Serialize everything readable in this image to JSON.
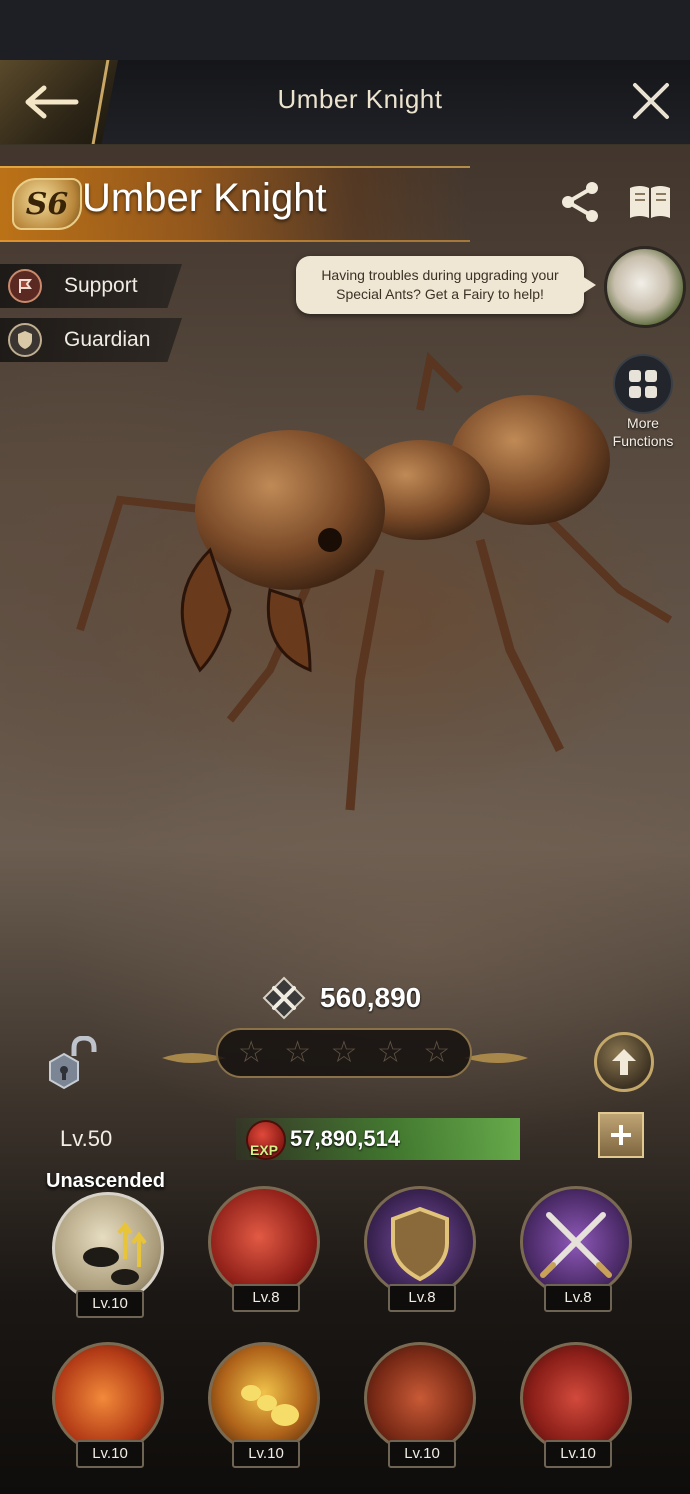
{
  "header": {
    "title": "Umber Knight"
  },
  "hero": {
    "grade": "S6",
    "name": "Umber Knight",
    "roles": [
      {
        "label": "Support",
        "icon": "support-flag-icon"
      },
      {
        "label": "Guardian",
        "icon": "shield-icon"
      }
    ],
    "power": "560,890",
    "stars": [
      "☆",
      "☆",
      "☆",
      "☆",
      "☆"
    ],
    "stars_filled": 0,
    "level": "Lv.50",
    "exp_tag": "EXP",
    "exp_value": "57,890,514"
  },
  "tip": {
    "text": "Having troubles during upgrading your Special Ants? Get a Fairy to help!"
  },
  "more_functions": {
    "label": "More Functions"
  },
  "ascension": {
    "label": "Unascended"
  },
  "skills": [
    {
      "name": "ascension-skill",
      "level": "Lv.10",
      "color": "#c9b98a"
    },
    {
      "name": "frenzy-strike-skill",
      "level": "Lv.8",
      "color": "#b3332a"
    },
    {
      "name": "golden-shield-skill",
      "level": "Lv.8",
      "color": "#5b3a7a"
    },
    {
      "name": "crossed-swords-skill",
      "level": "Lv.8",
      "color": "#6b3f8f"
    },
    {
      "name": "fire-pincer-skill",
      "level": "Lv.10",
      "color": "#d0561f"
    },
    {
      "name": "golden-ant-skill",
      "level": "Lv.10",
      "color": "#c4741c"
    },
    {
      "name": "ant-charge-skill",
      "level": "Lv.10",
      "color": "#9e3c22"
    },
    {
      "name": "red-burst-skill",
      "level": "Lv.10",
      "color": "#a62f25"
    }
  ]
}
